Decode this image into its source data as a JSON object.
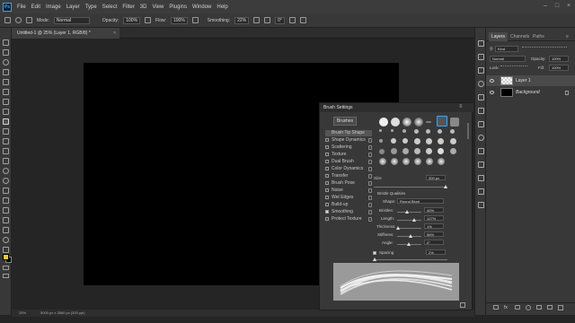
{
  "app": {
    "logo": "Ps"
  },
  "menu": [
    "File",
    "Edit",
    "Image",
    "Layer",
    "Type",
    "Select",
    "Filter",
    "3D",
    "View",
    "Plugins",
    "Window",
    "Help"
  ],
  "options": {
    "mode_label": "Mode:",
    "mode_value": "Normal",
    "opacity_label": "Opacity:",
    "opacity_value": "100%",
    "flow_label": "Flow:",
    "flow_value": "100%",
    "smoothing_label": "Smoothing:",
    "smoothing_value": "22%",
    "angle_value": "0°"
  },
  "document": {
    "tab_title": "Untitled-1 @ 25% (Layer 1, RGB/8) *",
    "status_zoom": "25%",
    "status_info": "5000 px x 2860 px (300 ppi)"
  },
  "brush_settings": {
    "title": "Brush Settings",
    "brushes_button": "Brushes",
    "options": [
      {
        "label": "Brush Tip Shape",
        "selected": true,
        "checkbox": false
      },
      {
        "label": "Shape Dynamics",
        "checked": false
      },
      {
        "label": "Scattering",
        "checked": false
      },
      {
        "label": "Texture",
        "checked": false
      },
      {
        "label": "Dual Brush",
        "checked": false
      },
      {
        "label": "Color Dynamics",
        "checked": false
      },
      {
        "label": "Transfer",
        "checked": false
      },
      {
        "label": "Brush Pose",
        "checked": false
      },
      {
        "label": "Noise",
        "checked": false
      },
      {
        "label": "Wet Edges",
        "checked": false
      },
      {
        "label": "Build-up",
        "checked": false
      },
      {
        "label": "Smoothing",
        "checked": true
      },
      {
        "label": "Protect Texture",
        "checked": false
      }
    ],
    "size_label": "Size",
    "size_value": "300 px",
    "bristle_title": "Bristle Qualities",
    "shape_label": "Shape:",
    "shape_value": "Round Blunt",
    "bristles_label": "Bristles:",
    "bristles_value": "40%",
    "length_label": "Length:",
    "length_value": "127%",
    "thickness_label": "Thickness:",
    "thickness_value": "1%",
    "stiffness_label": "Stiffness:",
    "stiffness_value": "56%",
    "angle_label": "Angle:",
    "angle_value": "0°",
    "spacing_label": "Spacing",
    "spacing_value": "2%"
  },
  "layers_panel": {
    "tabs": [
      "Layers",
      "Channels",
      "Paths"
    ],
    "kind_label": "Kind",
    "blend_mode": "Normal",
    "opacity_label": "Opacity:",
    "opacity_value": "100%",
    "lock_label": "Lock:",
    "fill_label": "Fill:",
    "fill_value": "100%",
    "layers": [
      "Layer 1",
      "Background"
    ]
  },
  "colors": {
    "foreground": "#f2d100",
    "background": "#000000"
  }
}
